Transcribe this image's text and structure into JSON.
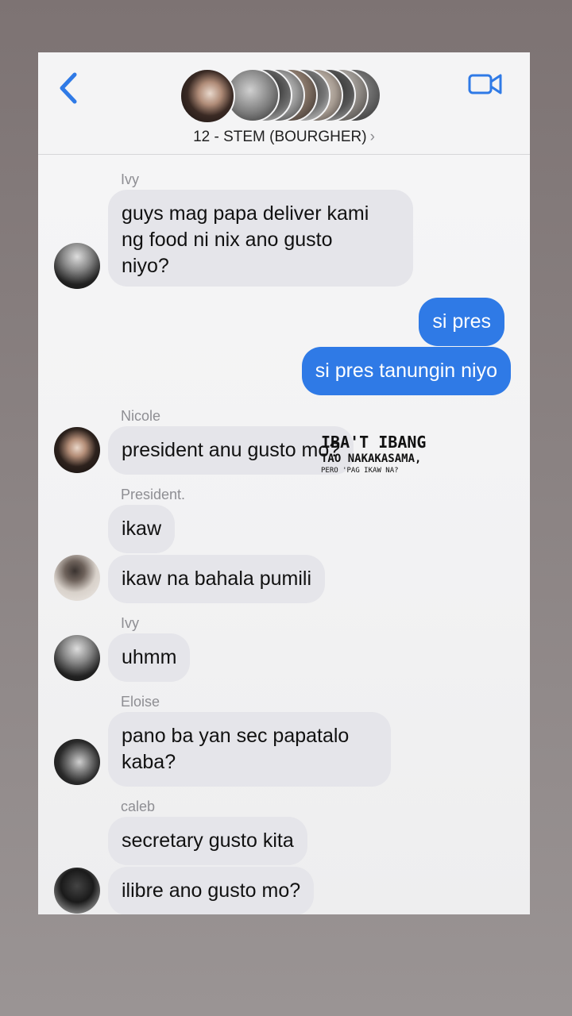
{
  "header": {
    "back_icon": "chevron-left-icon",
    "group_title": "12 - STEM (BOURGHER)",
    "title_chevron": "›",
    "video_icon": "video-camera-icon",
    "accent": "#2f7ae6"
  },
  "messages": [
    {
      "sender": "Ivy",
      "text": "guys mag papa deliver kami\nng food ni nix ano gusto\nniyo?"
    },
    {
      "sender": "",
      "text": "si pres"
    },
    {
      "sender": "",
      "text": "si pres tanungin niyo"
    },
    {
      "sender": "Nicole",
      "text": "president anu gusto mo?"
    },
    {
      "sender": "President.",
      "text": "ikaw"
    },
    {
      "sender": "",
      "text": "ikaw na bahala pumili"
    },
    {
      "sender": "Ivy",
      "text": "uhmm"
    },
    {
      "sender": "Eloise",
      "text": "pano ba yan sec papatalo\nkaba?"
    },
    {
      "sender": "caleb",
      "text": "secretary gusto kita"
    },
    {
      "sender": "",
      "text": "ilibre ano gusto mo?"
    }
  ],
  "overlay": {
    "line1": "IBA'T IBANG",
    "line2": "TAO NAKAKASAMA,",
    "line3": "PERO 'PAG IKAW NA?"
  },
  "colors": {
    "incoming_bubble": "#e5e5ea",
    "outgoing_bubble": "#2f7ae6",
    "sender_label": "#8e8e93"
  }
}
